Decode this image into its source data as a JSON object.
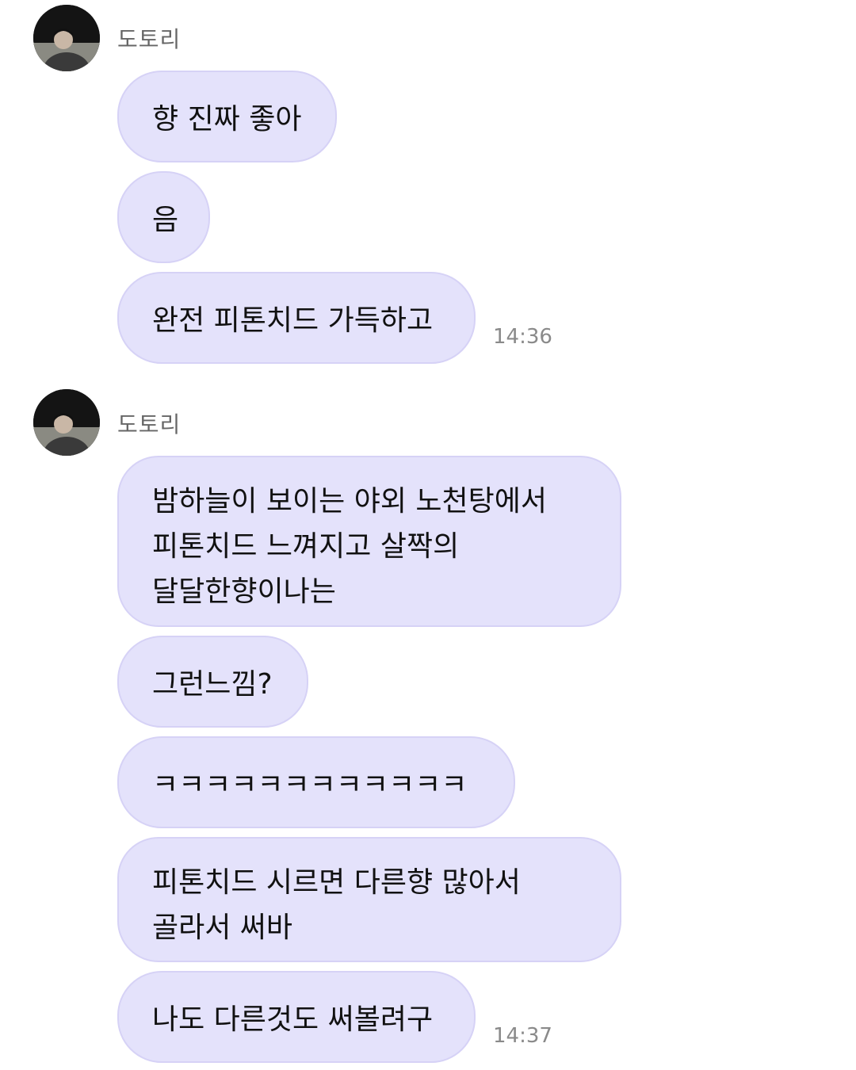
{
  "chat": {
    "groups": [
      {
        "sender": "도토리",
        "time": "14:36",
        "messages": [
          "향 진짜 좋아",
          "음",
          "완전 피톤치드 가득하고"
        ]
      },
      {
        "sender": "도토리",
        "time": "14:37",
        "messages": [
          "밤하늘이 보이는 야외 노천탕에서\n피톤치드 느껴지고 살짝의\n달달한향이나는",
          "그런느낌?",
          "ㅋㅋㅋㅋㅋㅋㅋㅋㅋㅋㅋㅋ",
          "피톤치드 시르면 다른향 많아서\n골라서 써바",
          "나도 다른것도 써볼려구"
        ]
      }
    ]
  },
  "colors": {
    "bubble_bg": "#e4e2fb",
    "bubble_border": "#d6d2f6",
    "sender_text": "#666666",
    "time_text": "#8a8a8a"
  },
  "icons": {
    "avatar": "profile-photo-person-at-night"
  }
}
